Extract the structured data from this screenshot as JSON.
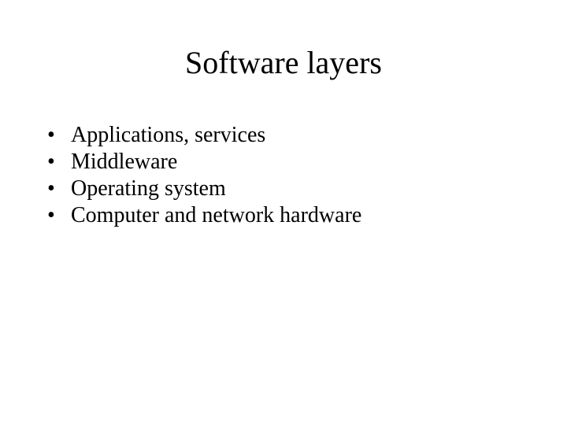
{
  "slide": {
    "title": "Software layers",
    "bullets": [
      "Applications, services",
      "Middleware",
      "Operating system",
      "Computer and network hardware"
    ]
  }
}
